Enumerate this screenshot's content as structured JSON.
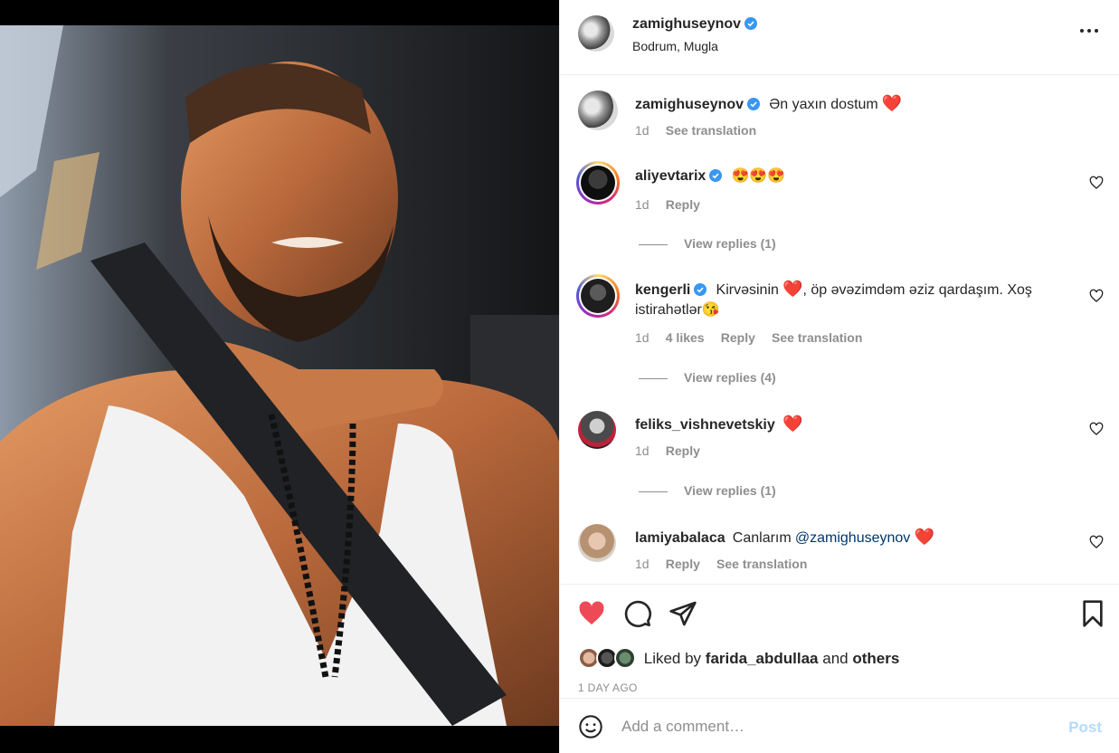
{
  "post": {
    "author": "zamighuseynov",
    "location": "Bodrum, Mugla"
  },
  "caption": {
    "username": "zamighuseynov",
    "text": "Ən yaxın dostum",
    "time": "1d",
    "translate_label": "See translation"
  },
  "comments": [
    {
      "username": "aliyevtarix",
      "text": "😍😍😍",
      "time": "1d",
      "reply_label": "Reply",
      "view_replies": "View replies (1)"
    },
    {
      "username": "kengerli",
      "text_before": "Kirvəsinin",
      "text_after": ", öp əvəzimdəm əziz qardaşım. Xoş",
      "text_line2": "istirahətlər😘",
      "time": "1d",
      "likes": "4 likes",
      "reply_label": "Reply",
      "translate_label": "See translation",
      "view_replies": "View replies (4)"
    },
    {
      "username": "feliks_vishnevetskiy",
      "time": "1d",
      "reply_label": "Reply",
      "view_replies": "View replies (1)"
    },
    {
      "username": "lamiyabalaca",
      "text": "Canlarım",
      "mention": "@zamighuseynov",
      "time": "1d",
      "reply_label": "Reply",
      "translate_label": "See translation"
    }
  ],
  "likes": {
    "prefix": "Liked by",
    "user": "farida_abdullaa",
    "and": "and",
    "others": "others"
  },
  "time_ago": "1 DAY AGO",
  "add_comment": {
    "placeholder": "Add a comment…",
    "post_label": "Post"
  },
  "colors": {
    "verified": "#3897f0",
    "heart": "#ed4956",
    "muted": "#8e8e8e",
    "post_disabled": "#b3dbff"
  }
}
